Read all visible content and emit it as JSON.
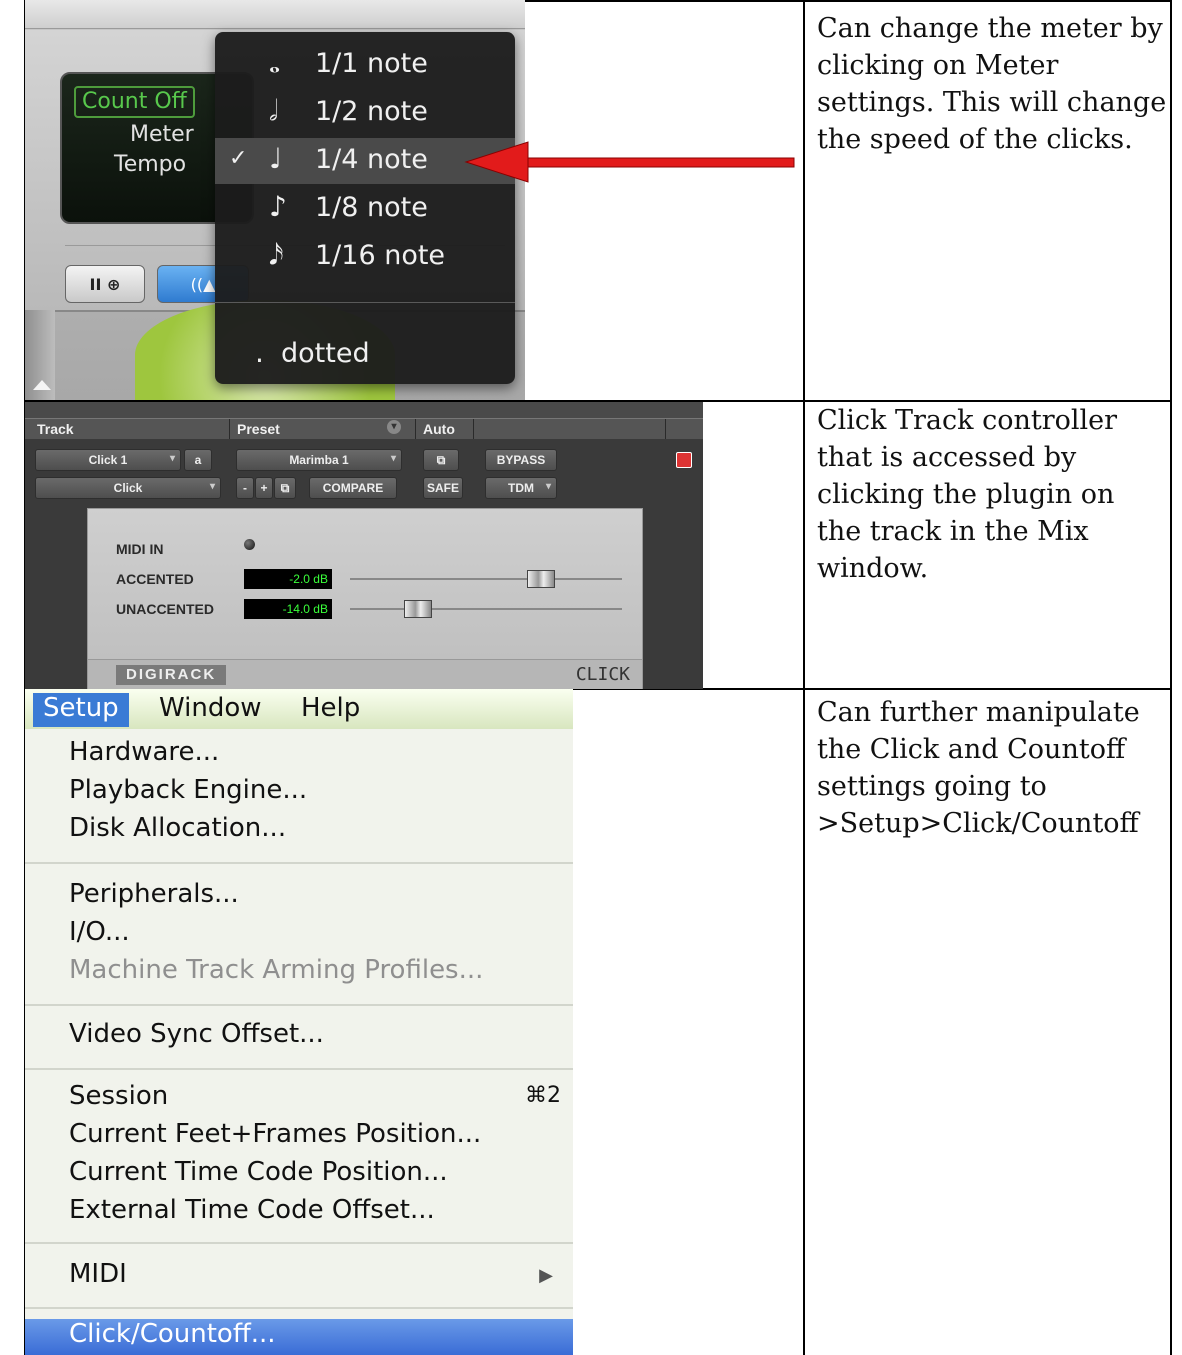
{
  "row1": {
    "lcd": {
      "count_off": "Count Off",
      "meter": "Meter",
      "tempo": "Tempo"
    },
    "popup": {
      "items": [
        {
          "glyph": "𝅝",
          "label": "1/1 note",
          "checked": false
        },
        {
          "glyph": "𝅗𝅥",
          "label": "1/2 note",
          "checked": false
        },
        {
          "glyph": "♩",
          "label": "1/4 note",
          "checked": true
        },
        {
          "glyph": "♪",
          "label": "1/8 note",
          "checked": false
        },
        {
          "glyph": "𝅘𝅥𝅯",
          "label": "1/16 note",
          "checked": false
        }
      ],
      "check_mark": "✓",
      "dotted": {
        "glyph": ".",
        "label": "dotted"
      }
    },
    "description": "Can change the meter by clicking on Meter settings.  This will change the speed of the clicks.",
    "arrow_color": "#e21b1b"
  },
  "row2": {
    "headers": {
      "track": "Track",
      "preset": "Preset",
      "auto": "Auto"
    },
    "track_name": "Click 1",
    "track_suffix": "a",
    "plugin_name": "Click",
    "preset_name": "Marimba 1",
    "preset_minus": "-",
    "preset_plus": "+",
    "compare": "COMPARE",
    "safe": "SAFE",
    "bypass": "BYPASS",
    "tdm": "TDM",
    "controls": {
      "midi_in": "MIDI IN",
      "accented": "ACCENTED",
      "accented_value": "-2.0 dB",
      "accented_level": 0.72,
      "unaccented": "UNACCENTED",
      "unaccented_value": "-14.0 dB",
      "unaccented_level": 0.22
    },
    "brand": "DIGIRACK",
    "plugin_label": "CLICK",
    "description": "Click Track controller that is accessed by clicking the plugin on the track in the Mix window."
  },
  "row3": {
    "menubar": {
      "setup": "Setup",
      "window": "Window",
      "help": "Help"
    },
    "menu_items": {
      "hardware": "Hardware...",
      "playback_engine": "Playback Engine...",
      "disk_allocation": "Disk Allocation...",
      "peripherals": "Peripherals...",
      "io": "I/O...",
      "machine_track": "Machine Track Arming Profiles...",
      "video_sync": "Video Sync Offset...",
      "session": "Session",
      "session_shortcut": "⌘2",
      "feet_frames": "Current Feet+Frames Position...",
      "time_code": "Current Time Code Position...",
      "external_time_code": "External Time Code Offset...",
      "midi": "MIDI",
      "click_countoff": "Click/Countoff..."
    },
    "description": "Can further manipulate the Click and Countoff settings going to >Setup>Click/Countoff"
  }
}
